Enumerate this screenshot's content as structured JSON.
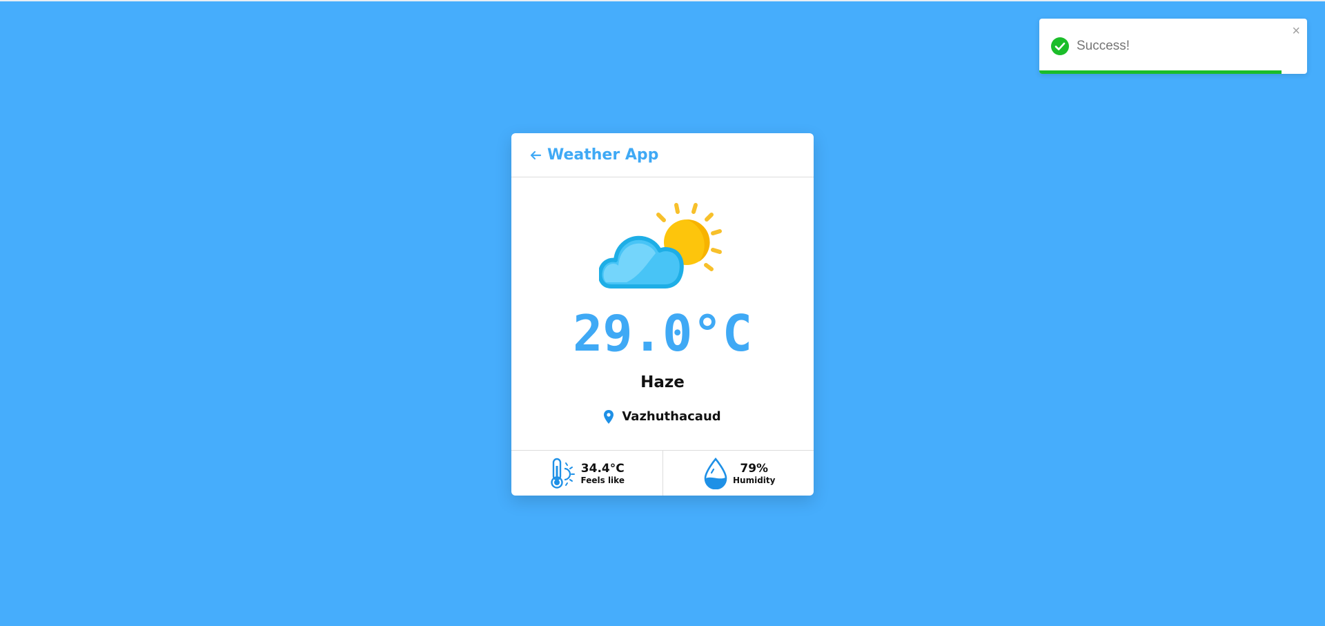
{
  "toast": {
    "message": "Success!",
    "close_label": "×",
    "progress": 0.905,
    "status_color": "#1bbd2a",
    "icon": "check-circle-icon"
  },
  "app": {
    "title": "Weather App",
    "back_icon": "arrow-left-icon",
    "accent": "#3fa9f5",
    "background": "#46adfc"
  },
  "weather": {
    "icon": "partly-cloudy-icon",
    "temperature": "29.0°C",
    "condition": "Haze",
    "location": "Vazhuthacaud",
    "location_icon": "map-pin-icon"
  },
  "stats": [
    {
      "icon": "thermometer-sun-icon",
      "value": "34.4°C",
      "label": "Feels like"
    },
    {
      "icon": "water-drop-icon",
      "value": "79%",
      "label": "Humidity"
    }
  ]
}
